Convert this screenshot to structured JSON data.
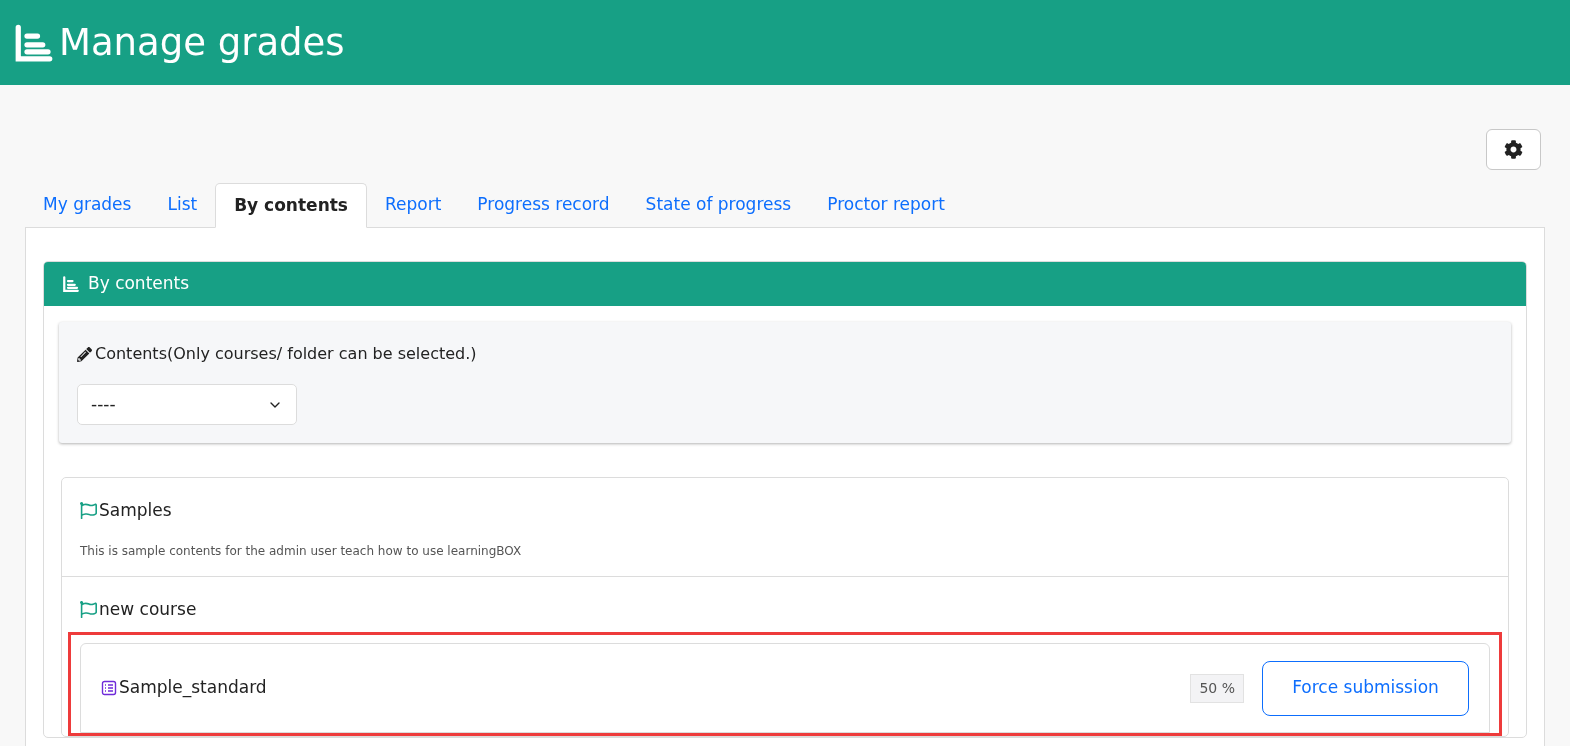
{
  "header": {
    "title": "Manage grades"
  },
  "tabs": [
    {
      "label": "My grades",
      "selected": false
    },
    {
      "label": "List",
      "selected": false
    },
    {
      "label": "By contents",
      "selected": true
    },
    {
      "label": "Report",
      "selected": false
    },
    {
      "label": "Progress record",
      "selected": false
    },
    {
      "label": "State of progress",
      "selected": false
    },
    {
      "label": "Proctor report",
      "selected": false
    }
  ],
  "card": {
    "title": "By contents",
    "filter": {
      "label": "Contents(Only courses/ folder can be selected.)",
      "value": "----"
    }
  },
  "courses": [
    {
      "name": "Samples",
      "description": "This is sample contents for the admin user teach how to use learningBOX"
    },
    {
      "name": "new course",
      "items": [
        {
          "name": "Sample_standard",
          "badge": "50 %",
          "button": "Force submission",
          "highlighted": true
        }
      ]
    }
  ]
}
